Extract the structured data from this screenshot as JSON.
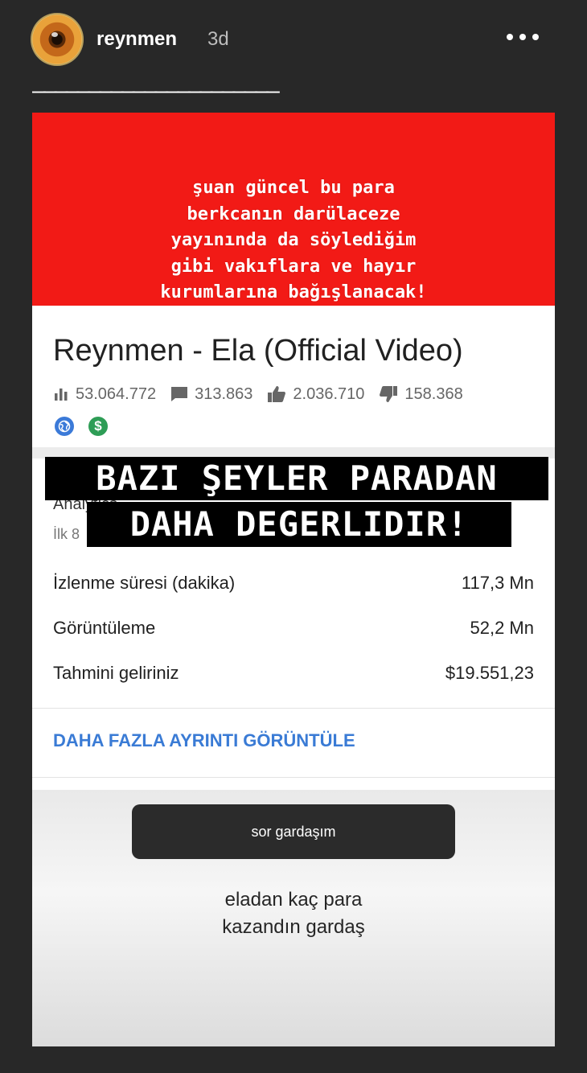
{
  "story": {
    "username": "reynmen",
    "time": "3d",
    "dashes": "——————————————————————"
  },
  "banner": {
    "text": "şuan güncel bu para\nberkcanın darülaceze\nyayınında da söylediğim\ngibi vakıflara ve hayır\nkurumlarına bağışlanacak!"
  },
  "video": {
    "title": "Reynmen - Ela (Official Video)",
    "stats": {
      "views": "53.064.772",
      "comments": "313.863",
      "likes": "2.036.710",
      "dislikes": "158.368"
    },
    "badges": [
      "globe-icon",
      "dollar-icon"
    ],
    "analytics_label": "Analytics",
    "period_label": "İlk 8"
  },
  "overlay": {
    "line1": "BAZI ŞEYLER PARADAN",
    "line2": "DAHA DEGERLIDIR!"
  },
  "metrics": [
    {
      "label": "İzlenme süresi (dakika)",
      "value": "117,3 Mn"
    },
    {
      "label": "Görüntüleme",
      "value": "52,2 Mn"
    },
    {
      "label": "Tahmini geliriniz",
      "value": "$19.551,23"
    }
  ],
  "more_details": "DAHA FAZLA AYRINTI GÖRÜNTÜLE",
  "question": {
    "prompt": "sor gardaşım",
    "answer": "eladan kaç para\nkazandın gardaş"
  },
  "colors": {
    "banner_red": "#f21a16",
    "link_blue": "#3a7bd5"
  }
}
